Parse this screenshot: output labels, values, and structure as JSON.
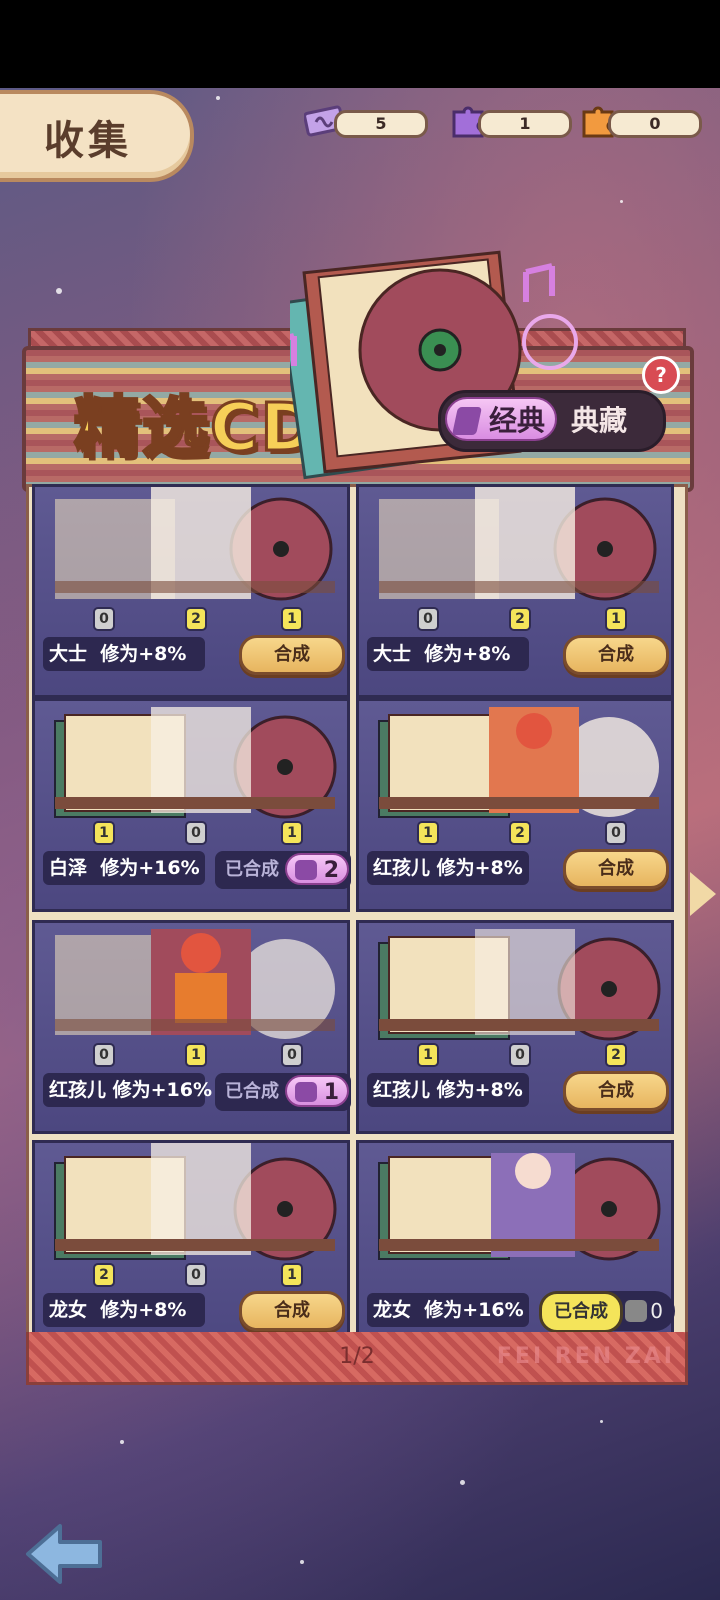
{
  "header": {
    "title": "收集",
    "resources": [
      {
        "icon": "ticket-icon",
        "value": "5"
      },
      {
        "icon": "purple-puzzle-icon",
        "value": "1"
      },
      {
        "icon": "orange-puzzle-icon",
        "value": "0"
      }
    ]
  },
  "banner": {
    "title": "精选CD",
    "toggle_active": "经典",
    "toggle_inactive": "典藏",
    "help": "?"
  },
  "cards": [
    {
      "counts": [
        "0",
        "2",
        "1"
      ],
      "name": "大士",
      "bonus": "修为+8%",
      "action": "合成",
      "state": "craft"
    },
    {
      "counts": [
        "0",
        "2",
        "1"
      ],
      "name": "大士",
      "bonus": "修为+8%",
      "action": "合成",
      "state": "craft"
    },
    {
      "counts": [
        "1",
        "0",
        "1"
      ],
      "name": "白泽",
      "bonus": "修为+16%",
      "action": "已合成",
      "pieces": "2",
      "state": "done"
    },
    {
      "counts": [
        "1",
        "2",
        "0"
      ],
      "name": "红孩儿",
      "bonus": "修为+8%",
      "action": "合成",
      "state": "craft"
    },
    {
      "counts": [
        "0",
        "1",
        "0"
      ],
      "name": "红孩儿",
      "bonus": "修为+16%",
      "action": "已合成",
      "pieces": "1",
      "state": "done"
    },
    {
      "counts": [
        "1",
        "0",
        "2"
      ],
      "name": "红孩儿",
      "bonus": "修为+8%",
      "action": "合成",
      "state": "craft"
    },
    {
      "counts": [
        "2",
        "0",
        "1"
      ],
      "name": "龙女",
      "bonus": "修为+8%",
      "action": "合成",
      "state": "craft"
    },
    {
      "counts": [],
      "name": "龙女",
      "bonus": "修为+16%",
      "action": "已合成",
      "pieces": "0",
      "state": "done-gold"
    }
  ],
  "footer": {
    "page": "1/2",
    "brand": "FEI REN ZAI"
  },
  "colors": {
    "accent_gold": "#f6cf58",
    "card_bg": "#5f5a93",
    "button": "#e7b55f",
    "pink": "#d98de2"
  }
}
